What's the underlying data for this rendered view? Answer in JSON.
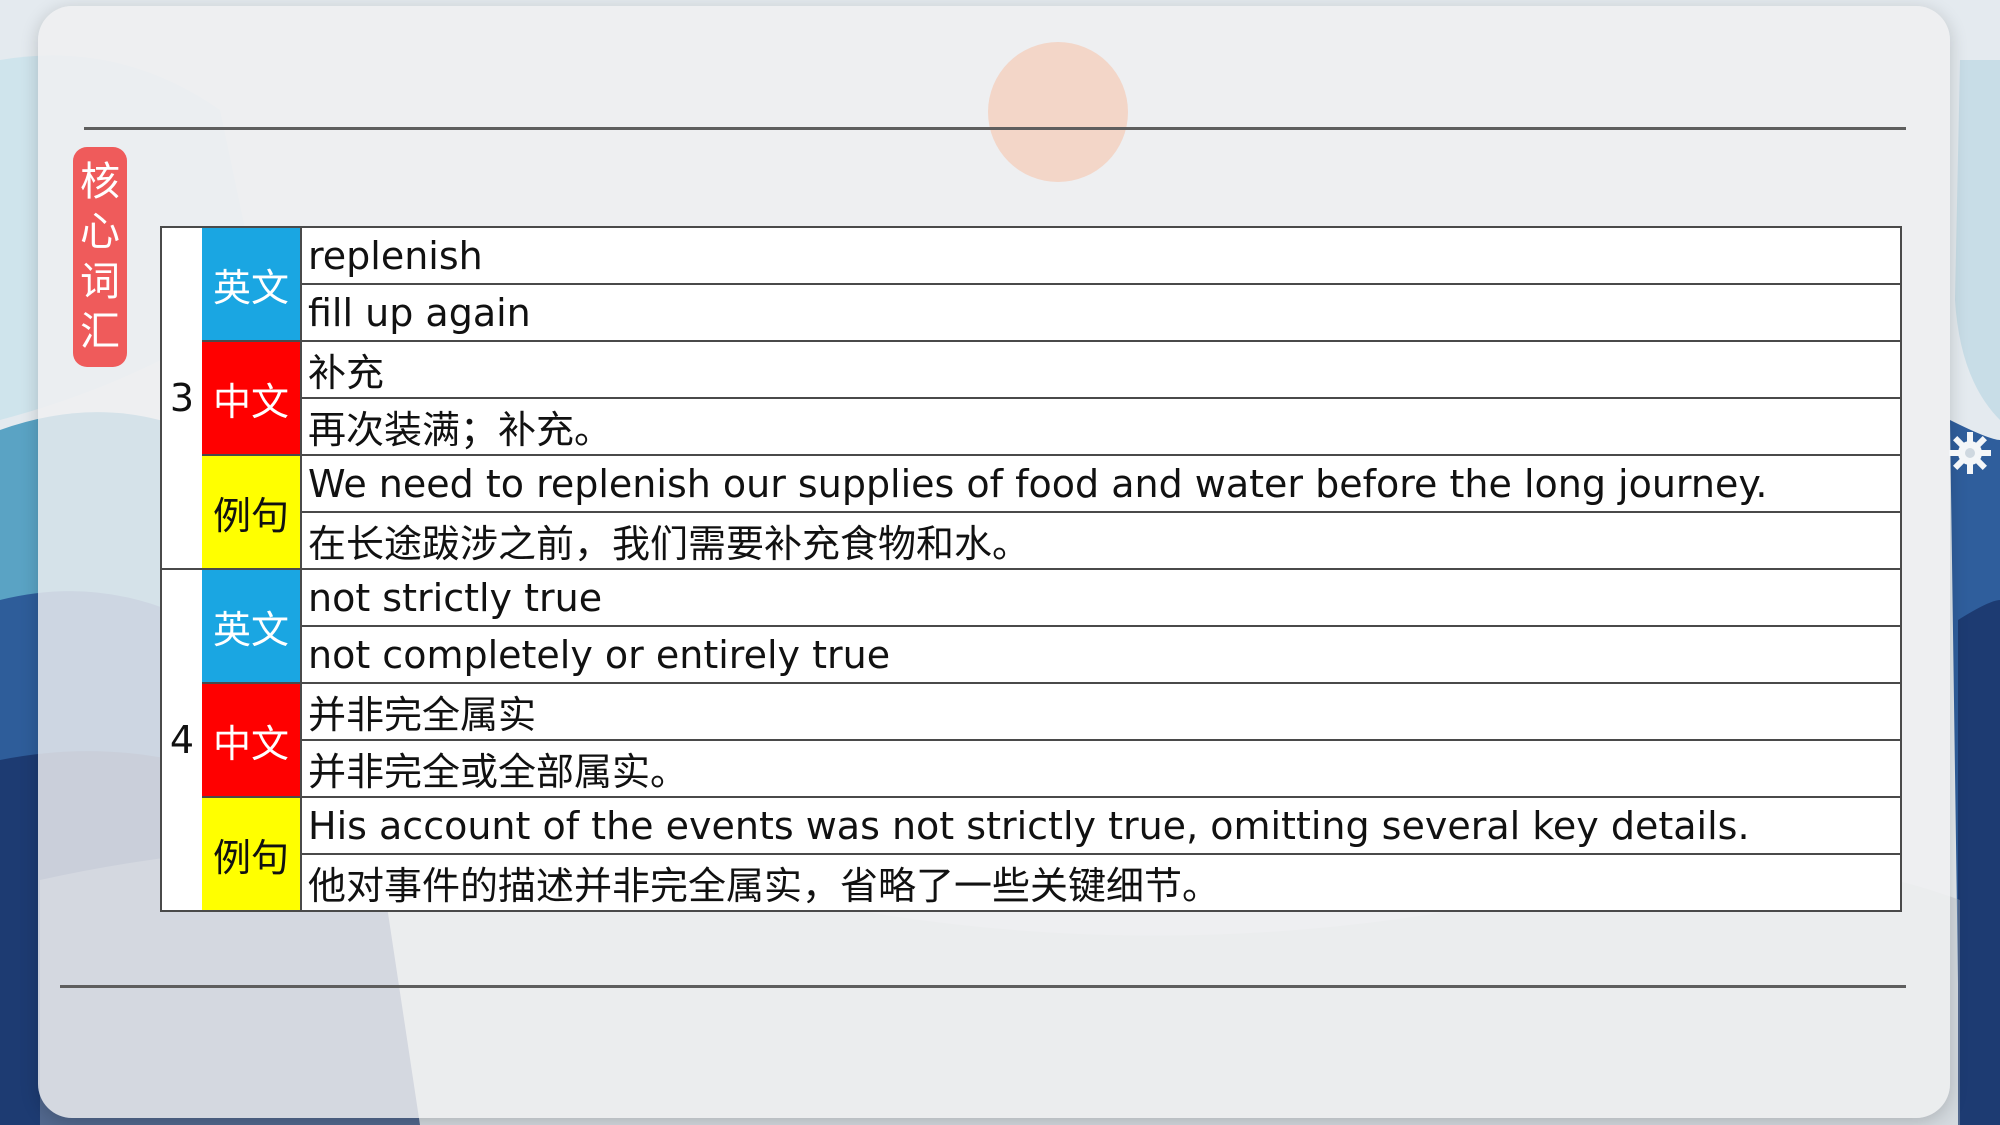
{
  "badge": {
    "chars": [
      "核",
      "心",
      "词",
      "汇"
    ]
  },
  "colors": {
    "english_label": "#1aa6e2",
    "chinese_label": "#ff0000",
    "example_label": "#ffff00",
    "badge": "#ef5b5b"
  },
  "labels": {
    "english": "英文",
    "chinese": "中文",
    "example": "例句"
  },
  "entries": [
    {
      "number": "3",
      "english_word": "replenish",
      "english_definition": "fill up again",
      "chinese_word": "补充",
      "chinese_definition": "再次装满；补充。",
      "example_en": "We need to replenish our supplies of food and water before the long journey.",
      "example_zh": "在长途跋涉之前，我们需要补充食物和水。"
    },
    {
      "number": "4",
      "english_word": "not strictly true",
      "english_definition": "not completely or entirely true",
      "chinese_word": "并非完全属实",
      "chinese_definition": "并非完全或全部属实。",
      "example_en": "His account of the events was not strictly true, omitting several key details.",
      "example_zh": "他对事件的描述并非完全属实，省略了一些关键细节。"
    }
  ]
}
